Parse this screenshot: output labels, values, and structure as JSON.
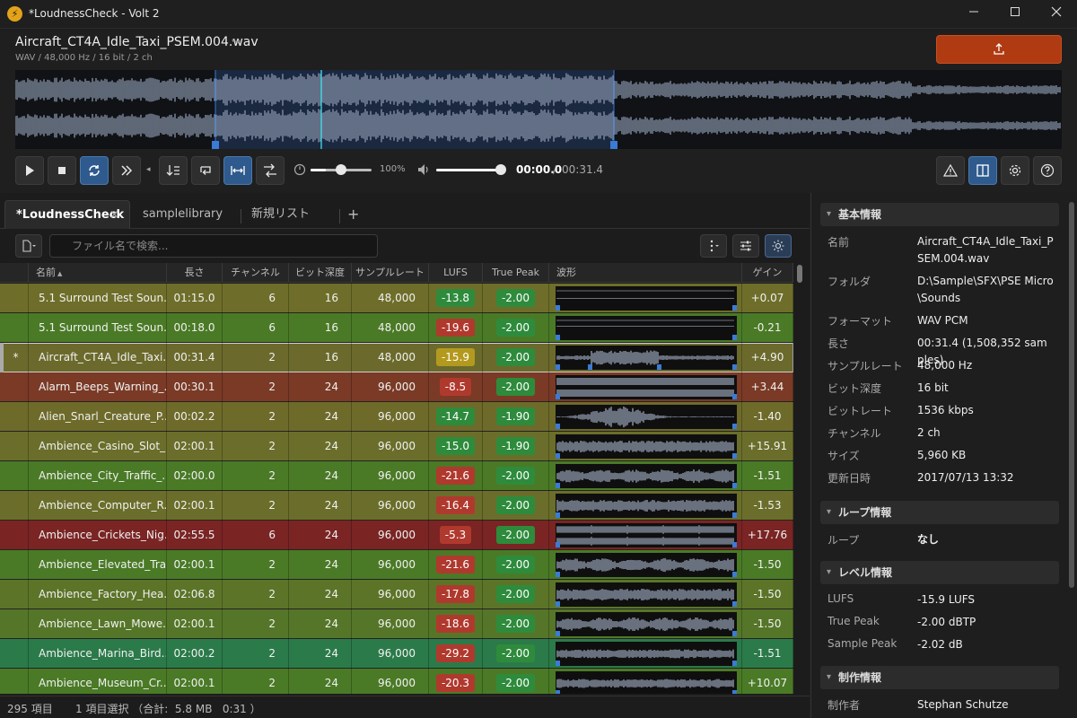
{
  "window": {
    "title": "*LoudnessCheck - Volt 2",
    "app_icon": "lightning-icon"
  },
  "file": {
    "name": "Aircraft_CT4A_Idle_Taxi_PSEM.004.wav",
    "meta": "WAV / 48,000 Hz / 16 bit / 2 ch"
  },
  "transport": {
    "zoom": "100%",
    "position": "00:00.0",
    "separator": "/",
    "duration": "00:31.4",
    "speed_level": 0.25,
    "volume_level": 1.0
  },
  "tabs": [
    {
      "label": "*LoudnessCheck",
      "close": "×"
    },
    {
      "label": "samplelibrary"
    },
    {
      "label": "新規リスト"
    }
  ],
  "add_tab": "+",
  "search": {
    "placeholder": "ファイル名で検索..."
  },
  "columns": [
    "名前",
    "長さ",
    "チャンネル",
    "ビット深度",
    "サンプルレート",
    "LUFS",
    "True Peak",
    "波形",
    "ゲイン"
  ],
  "sort_arrow": "▲",
  "rows": [
    {
      "mark": "",
      "name": "5.1 Surround Test Soun...",
      "length": "01:15.0",
      "channels": "6",
      "bits": "16",
      "rate": "48,000",
      "lufs": "-13.8",
      "peak": "-2.00",
      "gain": "+0.07",
      "bg": "#6e6e2a",
      "lufs_color": "#2e8b3c"
    },
    {
      "mark": "",
      "name": "5.1 Surround Test Soun...",
      "length": "00:18.0",
      "channels": "6",
      "bits": "16",
      "rate": "48,000",
      "lufs": "-19.6",
      "peak": "-2.00",
      "gain": "-0.21",
      "bg": "#4a7a26",
      "lufs_color": "#b0392e"
    },
    {
      "mark": "*",
      "name": "Aircraft_CT4A_Idle_Taxi...",
      "length": "00:31.4",
      "channels": "2",
      "bits": "16",
      "rate": "48,000",
      "lufs": "-15.9",
      "peak": "-2.00",
      "gain": "+4.90",
      "bg": "#6b6a2c",
      "lufs_color": "#b39a1e"
    },
    {
      "mark": "",
      "name": "Alarm_Beeps_Warning_...",
      "length": "00:30.1",
      "channels": "2",
      "bits": "24",
      "rate": "96,000",
      "lufs": "-8.5",
      "peak": "-2.00",
      "gain": "+3.44",
      "bg": "#7a3a26",
      "lufs_color": "#b0392e"
    },
    {
      "mark": "",
      "name": "Alien_Snarl_Creature_P...",
      "length": "00:02.2",
      "channels": "2",
      "bits": "24",
      "rate": "96,000",
      "lufs": "-14.7",
      "peak": "-1.90",
      "gain": "-1.40",
      "bg": "#6e6a2a",
      "lufs_color": "#2e8b3c"
    },
    {
      "mark": "",
      "name": "Ambience_Casino_Slot_...",
      "length": "02:00.1",
      "channels": "2",
      "bits": "24",
      "rate": "96,000",
      "lufs": "-15.0",
      "peak": "-1.90",
      "gain": "+15.91",
      "bg": "#6a6e2a",
      "lufs_color": "#2e8b3c"
    },
    {
      "mark": "",
      "name": "Ambience_City_Traffic_...",
      "length": "02:00.0",
      "channels": "2",
      "bits": "24",
      "rate": "96,000",
      "lufs": "-21.6",
      "peak": "-2.00",
      "gain": "-1.51",
      "bg": "#4a7a26",
      "lufs_color": "#b0392e"
    },
    {
      "mark": "",
      "name": "Ambience_Computer_R...",
      "length": "02:00.1",
      "channels": "2",
      "bits": "24",
      "rate": "96,000",
      "lufs": "-16.4",
      "peak": "-2.00",
      "gain": "-1.53",
      "bg": "#6a6e2a",
      "lufs_color": "#b0392e"
    },
    {
      "mark": "",
      "name": "Ambience_Crickets_Nig...",
      "length": "02:55.5",
      "channels": "6",
      "bits": "24",
      "rate": "96,000",
      "lufs": "-5.3",
      "peak": "-2.00",
      "gain": "+17.76",
      "bg": "#7a2424",
      "lufs_color": "#b0392e"
    },
    {
      "mark": "",
      "name": "Ambience_Elevated_Tra...",
      "length": "02:00.1",
      "channels": "2",
      "bits": "24",
      "rate": "96,000",
      "lufs": "-21.6",
      "peak": "-2.00",
      "gain": "-1.50",
      "bg": "#4a7a26",
      "lufs_color": "#b0392e"
    },
    {
      "mark": "",
      "name": "Ambience_Factory_Hea...",
      "length": "02:06.8",
      "channels": "2",
      "bits": "24",
      "rate": "96,000",
      "lufs": "-17.8",
      "peak": "-2.00",
      "gain": "-1.50",
      "bg": "#5c7428",
      "lufs_color": "#b0392e"
    },
    {
      "mark": "",
      "name": "Ambience_Lawn_Mowe...",
      "length": "02:00.1",
      "channels": "2",
      "bits": "24",
      "rate": "96,000",
      "lufs": "-18.6",
      "peak": "-2.00",
      "gain": "-1.50",
      "bg": "#557628",
      "lufs_color": "#b0392e"
    },
    {
      "mark": "",
      "name": "Ambience_Marina_Bird...",
      "length": "02:00.2",
      "channels": "2",
      "bits": "24",
      "rate": "96,000",
      "lufs": "-29.2",
      "peak": "-2.00",
      "gain": "-1.51",
      "bg": "#2b7a4a",
      "lufs_color": "#b0392e"
    },
    {
      "mark": "",
      "name": "Ambience_Museum_Cr...",
      "length": "02:00.1",
      "channels": "2",
      "bits": "24",
      "rate": "96,000",
      "lufs": "-20.3",
      "peak": "-2.00",
      "gain": "+10.07",
      "bg": "#4a7a26",
      "lufs_color": "#b0392e"
    }
  ],
  "status": {
    "count": "295 項目",
    "selection": "1 項目選択 （合計:  5.8 MB   0:31 ）"
  },
  "props": {
    "basic": {
      "title": "基本情報",
      "items": [
        {
          "key": "名前",
          "value": "Aircraft_CT4A_Idle_Taxi_PSEM.004.wav"
        },
        {
          "key": "フォルダ",
          "value": "D:\\Sample\\SFX\\PSE Micro\\Sounds"
        },
        {
          "key": "フォーマット",
          "value": "WAV PCM"
        },
        {
          "key": "長さ",
          "value": "00:31.4 (1,508,352 samples)"
        },
        {
          "key": "サンプルレート",
          "value": "48,000 Hz"
        },
        {
          "key": "ビット深度",
          "value": "16 bit"
        },
        {
          "key": "ビットレート",
          "value": "1536 kbps"
        },
        {
          "key": "チャンネル",
          "value": "2 ch"
        },
        {
          "key": "サイズ",
          "value": "5,960 KB"
        },
        {
          "key": "更新日時",
          "value": "2017/07/13 13:32"
        }
      ]
    },
    "loop": {
      "title": "ループ情報",
      "items": [
        {
          "key": "ループ",
          "value": "なし"
        }
      ]
    },
    "level": {
      "title": "レベル情報",
      "items": [
        {
          "key": "LUFS",
          "value": "-15.9 LUFS"
        },
        {
          "key": "True Peak",
          "value": "-2.00 dBTP"
        },
        {
          "key": "Sample Peak",
          "value": "-2.02 dB"
        }
      ]
    },
    "production": {
      "title": "制作情報",
      "items": [
        {
          "key": "制作者",
          "value": "Stephan Schutze"
        }
      ]
    }
  }
}
